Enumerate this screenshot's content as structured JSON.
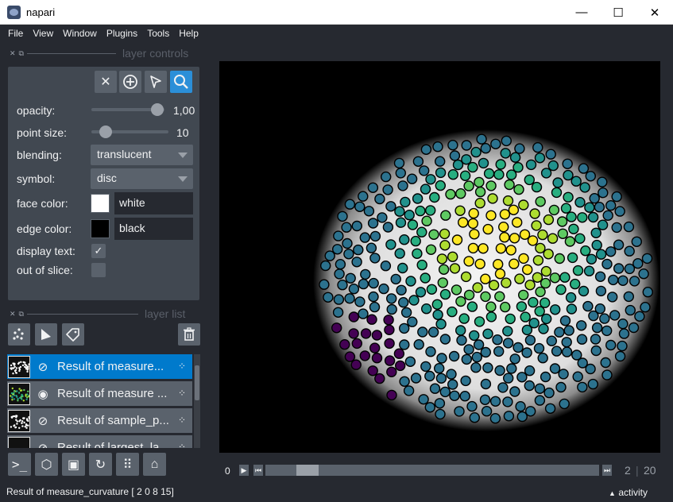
{
  "window": {
    "title": "napari",
    "minimize": "—",
    "maximize": "☐",
    "close": "✕"
  },
  "menu": [
    "File",
    "View",
    "Window",
    "Plugins",
    "Tools",
    "Help"
  ],
  "layer_controls": {
    "header": "layer controls",
    "opacity_label": "opacity:",
    "opacity_value": "1,00",
    "opacity": 0.9,
    "point_size_label": "point size:",
    "point_size_value": "10",
    "point_size_fraction": 0.1,
    "blending_label": "blending:",
    "blending_value": "translucent",
    "symbol_label": "symbol:",
    "symbol_value": "disc",
    "face_color_label": "face color:",
    "face_color_value": "white",
    "face_color": "#ffffff",
    "edge_color_label": "edge color:",
    "edge_color_value": "black",
    "edge_color": "#000000",
    "display_text_label": "display text:",
    "display_text_checked": true,
    "out_of_slice_label": "out of slice:",
    "out_of_slice_checked": false
  },
  "layer_list": {
    "header": "layer list",
    "layers": [
      {
        "name": "Result of measure...",
        "visible": false,
        "selected": true
      },
      {
        "name": "Result of measure ...",
        "visible": true,
        "selected": false
      },
      {
        "name": "Result of sample_p...",
        "visible": false,
        "selected": false
      },
      {
        "name": "Result of largest_la...",
        "visible": false,
        "selected": false
      }
    ]
  },
  "dims": {
    "current": "0",
    "index": "2",
    "total": "20",
    "slider_fraction": 0.07
  },
  "status": {
    "message": "Result of measure_curvature [ 2  0  8 15]",
    "activity": "activity"
  },
  "colors": {
    "background": "#262930",
    "panel": "#414851",
    "control": "#5a626c",
    "accent": "#007acc",
    "active_tool": "#2b8fd8"
  }
}
